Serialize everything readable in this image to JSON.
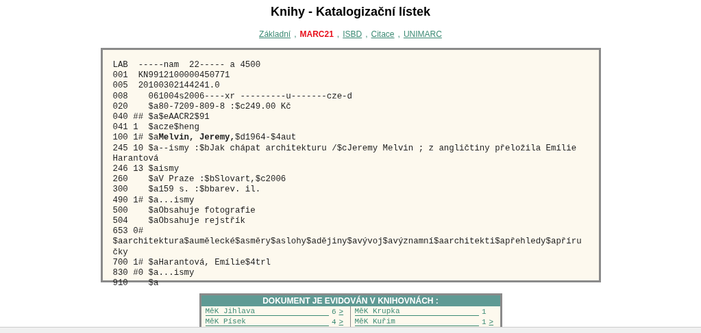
{
  "title": "Knihy - Katalogizační lístek",
  "format_separator": ",",
  "formats": [
    {
      "label": "Základní",
      "selected": false
    },
    {
      "label": "MARC21",
      "selected": true
    },
    {
      "label": "ISBD",
      "selected": false
    },
    {
      "label": "Citace",
      "selected": false
    },
    {
      "label": "UNIMARC",
      "selected": false
    }
  ],
  "record_lines": [
    "LAB  -----nam  22----- a 4500",
    "001  KN9912100000450771",
    "005  20100302144241.0",
    "008    061004s2006----xr ---------u-------cze-d",
    "020    $a80-7209-809-8 :$c249.00 Kč",
    "040 ## $a$eAACR2$91",
    "041 1  $acze$heng",
    "100 1# $a**Melvin, Jeremy,**$d1964-$4aut",
    "245 10 $a--ismy :$bJak chápat architekturu /$cJeremy Melvin ; z angličtiny přeložila Emílie Harantová",
    "246 13 $aismy",
    "260    $aV Praze :$bSlovart,$c2006",
    "300    $a159 s. :$bbarev. il.",
    "490 1# $a...ismy",
    "500    $aObsahuje fotografie",
    "504    $aObsahuje rejstřík",
    "653 0# $aarchitektura$aumělecké$asměry$aslohy$adějiny$avývoj$avýznamní$aarchitekti$apřehledy$apříručky",
    "700 1# $aHarantová, Emílie$4trl",
    "830 #0 $a...ismy",
    "910    $a"
  ],
  "libraries": {
    "heading": "DOKUMENT JE EVIDOVÁN V KNIHOVNÁCH :",
    "items": [
      {
        "name": "MěK Jihlava",
        "count": "6",
        "arrow": ">"
      },
      {
        "name": "MěK Krupka",
        "count": "1"
      },
      {
        "name": "MěK Písek",
        "count": "4",
        "arrow": ">"
      },
      {
        "name": "MěK Kuřim",
        "count": "1",
        "arrow": ">"
      }
    ]
  }
}
